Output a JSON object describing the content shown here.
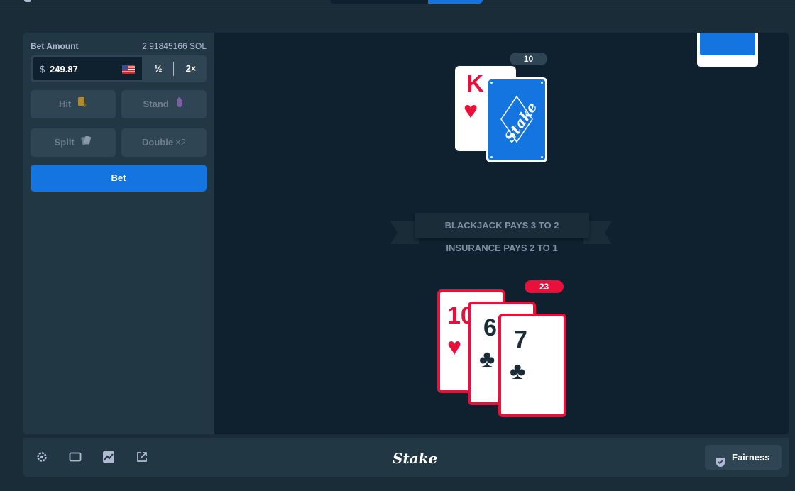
{
  "bet": {
    "label": "Bet Amount",
    "balance": "2.91845166 SOL",
    "currency_symbol": "$",
    "amount": "249.87",
    "half_label": "½",
    "double_label": "2×"
  },
  "actions": {
    "hit": "Hit",
    "stand": "Stand",
    "split": "Split",
    "double": "Double",
    "double_suffix": "×2",
    "bet": "Bet"
  },
  "table": {
    "banner": "BLACKJACK PAYS 3 TO 2",
    "insurance": "INSURANCE PAYS 2 TO 1",
    "deck_back_text": "Stake"
  },
  "dealer": {
    "score": "10",
    "cards": [
      {
        "rank": "K",
        "suit": "♥",
        "color": "#e9113c",
        "face": "up"
      },
      {
        "face": "down"
      }
    ]
  },
  "player": {
    "score": "23",
    "status_color": "#e9113c",
    "cards": [
      {
        "rank": "10",
        "suit": "♥",
        "color": "#e9113c"
      },
      {
        "rank": "6",
        "suit": "♣",
        "color": "#1a2c38"
      },
      {
        "rank": "7",
        "suit": "♣",
        "color": "#1a2c38"
      }
    ]
  },
  "footer": {
    "logo": "Stake",
    "fairness": "Fairness",
    "icons": [
      "gear-icon",
      "theatre-mode-icon",
      "stats-icon",
      "popout-icon"
    ]
  },
  "colors": {
    "accent": "#1475e1",
    "bust": "#e9113c",
    "panel": "#213743",
    "table": "#0f212e"
  }
}
